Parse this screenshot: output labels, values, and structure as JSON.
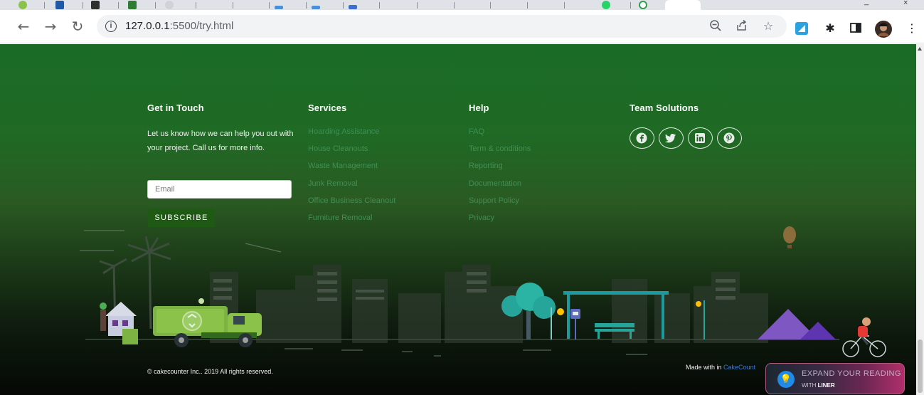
{
  "browser": {
    "url_host": "127.0.0.1",
    "url_rest": ":5500/try.html"
  },
  "footer": {
    "get_in_touch": {
      "heading": "Get in Touch",
      "text": "Let us know how we can help you out with your project. Call us for more info.",
      "email_placeholder": "Email",
      "subscribe_label": "SUBSCRIBE"
    },
    "services": {
      "heading": "Services",
      "items": [
        "Hoarding Assistance",
        "House Cleanouts",
        "Waste Management",
        "Junk Removal",
        "Office Business Cleanout",
        "Furniture Removal"
      ]
    },
    "help": {
      "heading": "Help",
      "items": [
        "FAQ",
        "Term & conditions",
        "Reporting",
        "Documentation",
        "Support Policy",
        "Privacy"
      ]
    },
    "team_solutions": {
      "heading": "Team Solutions",
      "social": [
        "facebook-icon",
        "twitter-icon",
        "linkedin-icon",
        "pinterest-icon"
      ]
    },
    "copyright": "© cakecounter Inc.. 2019 All rights reserved.",
    "made_with": "Made with in",
    "made_with_brand": "CakeCount"
  },
  "liner_widget": {
    "line1": "EXPAND YOUR READING",
    "line2_prefix": "WITH",
    "line2_brand": "LINER"
  },
  "colors": {
    "footer_green": "#1a6b26",
    "link_green": "#3f8f56",
    "subscribe_bg": "#1e5a14"
  }
}
